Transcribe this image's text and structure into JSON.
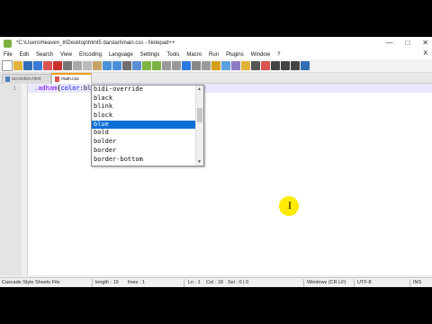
{
  "window": {
    "title": "*C:\\Users\\Heaven_8\\Desktop\\html5 darslari\\main.css - Notepad++",
    "controls": [
      "—",
      "□",
      "✕"
    ]
  },
  "menu": {
    "items": [
      "File",
      "Edit",
      "Search",
      "View",
      "Encoding",
      "Language",
      "Settings",
      "Tools",
      "Macro",
      "Run",
      "Plugins",
      "Window",
      "?"
    ],
    "close": "X"
  },
  "tabs": [
    {
      "label": "accordion.html",
      "active": false
    },
    {
      "label": "main.css",
      "active": true
    }
  ],
  "editor": {
    "line_number": "1",
    "code": {
      "selector": ".adham",
      "open_brace": "{",
      "property": "color",
      "colon": ":",
      "value": "blue;",
      "close_brace": "}"
    }
  },
  "autocomplete": {
    "items": [
      "bidi-override",
      "black",
      "blink",
      "block",
      "blue",
      "bold",
      "bolder",
      "border",
      "border-bottom"
    ],
    "selected": "blue",
    "scroll_up": "▲",
    "scroll_down": "▼"
  },
  "statusbar": {
    "file_type": "Cascade Style Sheets File",
    "length": "length : 19",
    "lines": "lines : 1",
    "ln": "Ln : 1",
    "col": "Col : 18",
    "sel": "Sel : 0 | 0",
    "eol": "Windows (CR LF)",
    "encoding": "UTF-8",
    "mode": "INS"
  },
  "cursor_symbol": "I",
  "colors": {
    "selector": "#8000ff",
    "property": "#0000ff",
    "selection": "#0a6fd8",
    "active_tab_accent": "#f39c12",
    "cursor_highlight": "#ffea00"
  },
  "toolbar_icons": [
    "new-file-icon",
    "open-file-icon",
    "save-icon",
    "save-all-icon",
    "close-icon",
    "close-all-icon",
    "print-icon",
    "cut-icon",
    "copy-icon",
    "paste-icon",
    "undo-icon",
    "redo-icon",
    "find-icon",
    "replace-icon",
    "zoom-in-icon",
    "zoom-out-icon",
    "sync-v-icon",
    "sync-h-icon",
    "wrap-icon",
    "all-chars-icon",
    "indent-guide-icon",
    "lang-icon",
    "doc-map-icon",
    "func-list-icon",
    "folder-icon",
    "monitor-icon",
    "record-icon",
    "stop-icon",
    "play-icon",
    "play-multi-icon",
    "save-macro-icon"
  ]
}
